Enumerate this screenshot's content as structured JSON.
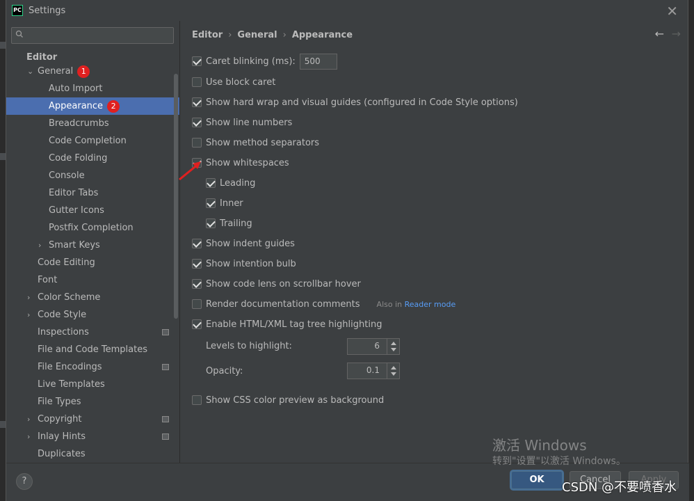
{
  "window": {
    "title": "Settings",
    "logo_text": "PC"
  },
  "breadcrumb": {
    "part1": "Editor",
    "part2": "General",
    "part3": "Appearance",
    "sep": "›"
  },
  "search": {
    "placeholder": "Q▾"
  },
  "sidebar": {
    "editor_header": "Editor",
    "items": [
      {
        "label": "General",
        "badge": "1"
      },
      {
        "label": "Auto Import"
      },
      {
        "label": "Appearance",
        "badge": "2"
      },
      {
        "label": "Breadcrumbs"
      },
      {
        "label": "Code Completion"
      },
      {
        "label": "Code Folding"
      },
      {
        "label": "Console"
      },
      {
        "label": "Editor Tabs"
      },
      {
        "label": "Gutter Icons"
      },
      {
        "label": "Postfix Completion"
      },
      {
        "label": "Smart Keys"
      },
      {
        "label": "Code Editing"
      },
      {
        "label": "Font"
      },
      {
        "label": "Color Scheme"
      },
      {
        "label": "Code Style"
      },
      {
        "label": "Inspections"
      },
      {
        "label": "File and Code Templates"
      },
      {
        "label": "File Encodings"
      },
      {
        "label": "Live Templates"
      },
      {
        "label": "File Types"
      },
      {
        "label": "Copyright"
      },
      {
        "label": "Inlay Hints"
      },
      {
        "label": "Duplicates"
      }
    ]
  },
  "options": {
    "caret_blinking": {
      "label": "Caret blinking (ms):",
      "checked": true,
      "value": "500"
    },
    "block_caret": {
      "label": "Use block caret",
      "checked": false
    },
    "hard_wrap": {
      "label": "Show hard wrap and visual guides (configured in Code Style options)",
      "checked": true
    },
    "line_numbers": {
      "label": "Show line numbers",
      "checked": true
    },
    "method_separators": {
      "label": "Show method separators",
      "checked": false
    },
    "whitespaces": {
      "label": "Show whitespaces",
      "checked": true
    },
    "leading": {
      "label": "Leading",
      "checked": true
    },
    "inner": {
      "label": "Inner",
      "checked": true
    },
    "trailing": {
      "label": "Trailing",
      "checked": true
    },
    "indent_guides": {
      "label": "Show indent guides",
      "checked": true
    },
    "intention_bulb": {
      "label": "Show intention bulb",
      "checked": true
    },
    "code_lens": {
      "label": "Show code lens on scrollbar hover",
      "checked": true
    },
    "render_docs": {
      "label": "Render documentation comments",
      "checked": false,
      "also_in": "Also in",
      "reader_mode": "Reader mode"
    },
    "html_tag_tree": {
      "label": "Enable HTML/XML tag tree highlighting",
      "checked": true
    },
    "levels": {
      "label": "Levels to highlight:",
      "value": "6"
    },
    "opacity": {
      "label": "Opacity:",
      "value": "0.1"
    },
    "css_preview": {
      "label": "Show CSS color preview as background",
      "checked": false
    }
  },
  "buttons": {
    "help": "?",
    "ok": "OK",
    "cancel": "Cancel",
    "apply": "Apply"
  },
  "watermark": {
    "line1": "激活 Windows",
    "line2": "转到\"设置\"以激活 Windows。",
    "csdn": "CSDN @不要喷香水"
  },
  "colors": {
    "selection": "#4b6eaf",
    "accent_link": "#589df6",
    "badge": "#e02020",
    "arrow": "#e02020"
  }
}
